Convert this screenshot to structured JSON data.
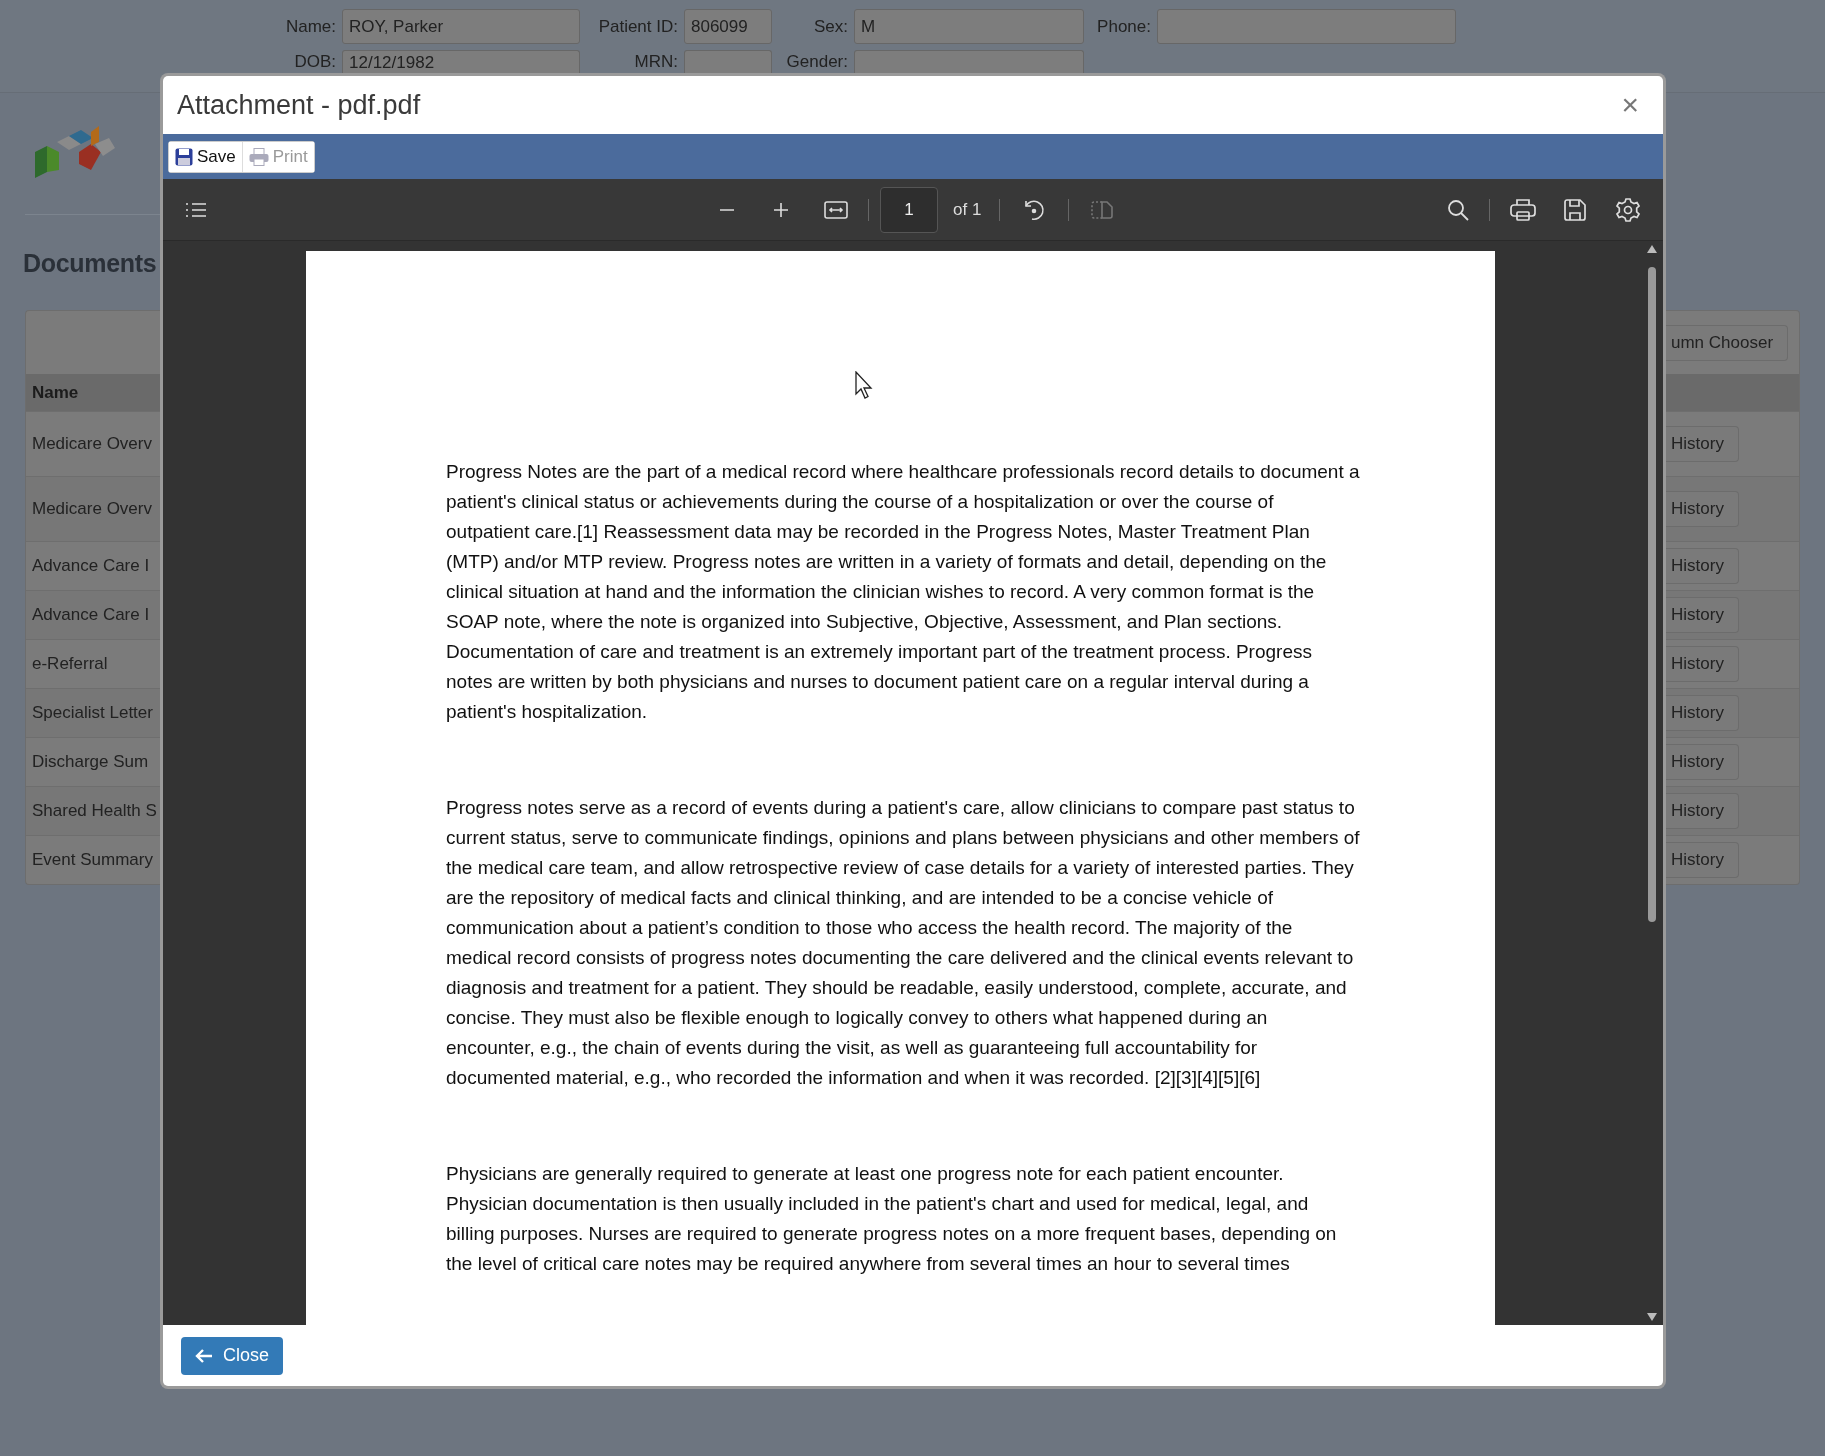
{
  "patient_header": {
    "fields": [
      {
        "label": "Name:",
        "value": "ROY, Parker"
      },
      {
        "label": "Patient ID:",
        "value": "806099"
      },
      {
        "label": "Sex:",
        "value": "M"
      },
      {
        "label": "Phone:"
      },
      {
        "label": "DOB:",
        "value": "12/12/1982"
      },
      {
        "label": "MRN:"
      },
      {
        "label": "Gender:"
      }
    ]
  },
  "documents": {
    "title": "Documents",
    "column_chooser": "umn Chooser",
    "columns": [
      "Name"
    ],
    "rows": [
      {
        "name": "Medicare Overv",
        "action": "History"
      },
      {
        "name": "Medicare Overv",
        "action": "History"
      },
      {
        "name": "Advance Care I",
        "action": "History"
      },
      {
        "name": "Advance Care I",
        "action": "History"
      },
      {
        "name": "e-Referral",
        "action": "History"
      },
      {
        "name": "Specialist Letter",
        "action": "History"
      },
      {
        "name": "Discharge Sum",
        "action": "History"
      },
      {
        "name": "Shared Health S",
        "action": "History"
      },
      {
        "name": "Event Summary",
        "action": "History"
      }
    ]
  },
  "dialog": {
    "title": "Attachment - pdf.pdf",
    "close_icon": "×",
    "actions": [
      {
        "kind": "save",
        "label": "Save",
        "disabled": false
      },
      {
        "kind": "print",
        "label": "Print",
        "disabled": true
      }
    ],
    "viewer": {
      "page_number": "1",
      "page_count": "of 1",
      "page_text": [
        "Progress Notes are the part of a medical record where healthcare professionals record details to document a patient's clinical status or achievements during the course of a hospitalization or over the course of outpatient care.[1] Reassessment data may be recorded in the Progress Notes, Master Treatment Plan (MTP) and/or MTP review. Progress notes are written in a variety of formats and detail, depending on the clinical situation at hand and the information the clinician wishes to record. A very common format is the SOAP note, where the note is organized into Subjective, Objective, Assessment, and Plan sections. Documentation of care and treatment is an extremely important part of the treatment process. Progress notes are written by both physicians and nurses to document patient care on a regular interval during a patient's hospitalization.",
        "Progress notes serve as a record of events during a patient's care, allow clinicians to compare past status to current status, serve to communicate findings, opinions and plans between physicians and other members of the medical care team, and allow retrospective review of case details for a variety of interested parties. They are the repository of medical facts and clinical thinking, and are intended to be a concise vehicle of communication about a patient’s condition to those who access the health record. The majority of the medical record consists of progress notes documenting the care delivered and the clinical events relevant to diagnosis and treatment for a patient. They should be readable, easily understood, complete, accurate, and concise. They must also be flexible enough to logically convey to others what happened during an encounter, e.g., the chain of events during the visit, as well as guaranteeing full accountability for documented material, e.g., who recorded the information and when it was recorded. [2][3][4][5][6]",
        "Physicians are generally required to generate at least one progress note for each patient encounter. Physician documentation is then usually included in the patient's chart and used for medical, legal, and billing purposes. Nurses are required to generate progress notes on a more frequent bases, depending on the level of critical care notes may be required anywhere from several times an hour to several times"
      ]
    },
    "close_button": "Close"
  }
}
